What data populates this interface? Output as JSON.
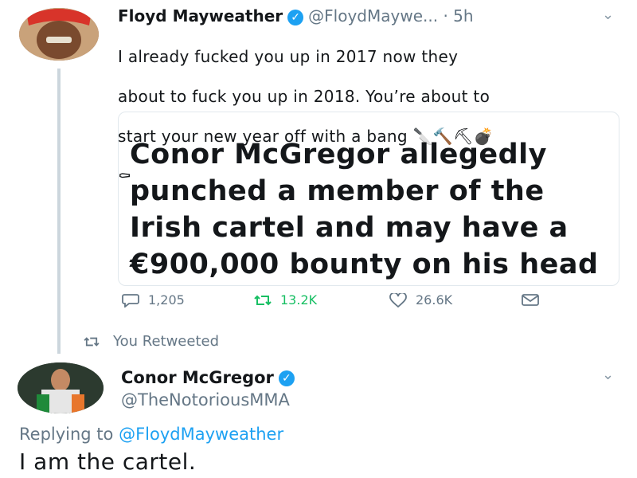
{
  "tweet1": {
    "author_name": "Floyd Mayweather",
    "handle": "@FloydMaywe...",
    "time": "· 5h",
    "text_lines": [
      "I already fucked you up in 2017 now they",
      "about to fuck you up in 2018. You’re about to",
      "start your new year off with a bang 🔪🔨⛏💣",
      "⚰"
    ],
    "card_title": "Conor McGregor allegedly punched a member of the Irish cartel and may have a €900,000 bounty on his head",
    "actions": {
      "replies": "1,205",
      "retweets": "13.2K",
      "likes": "26.6K"
    }
  },
  "retweet_notice": "You Retweeted",
  "tweet2": {
    "author_name": "Conor McGregor",
    "handle": "@TheNotoriousMMA",
    "replying_prefix": "Replying to",
    "replying_to": "@FloydMayweather",
    "text": "I am the cartel."
  },
  "colors": {
    "accent": "#1da1f2",
    "retweet_green": "#17bf63",
    "muted": "#657786"
  }
}
